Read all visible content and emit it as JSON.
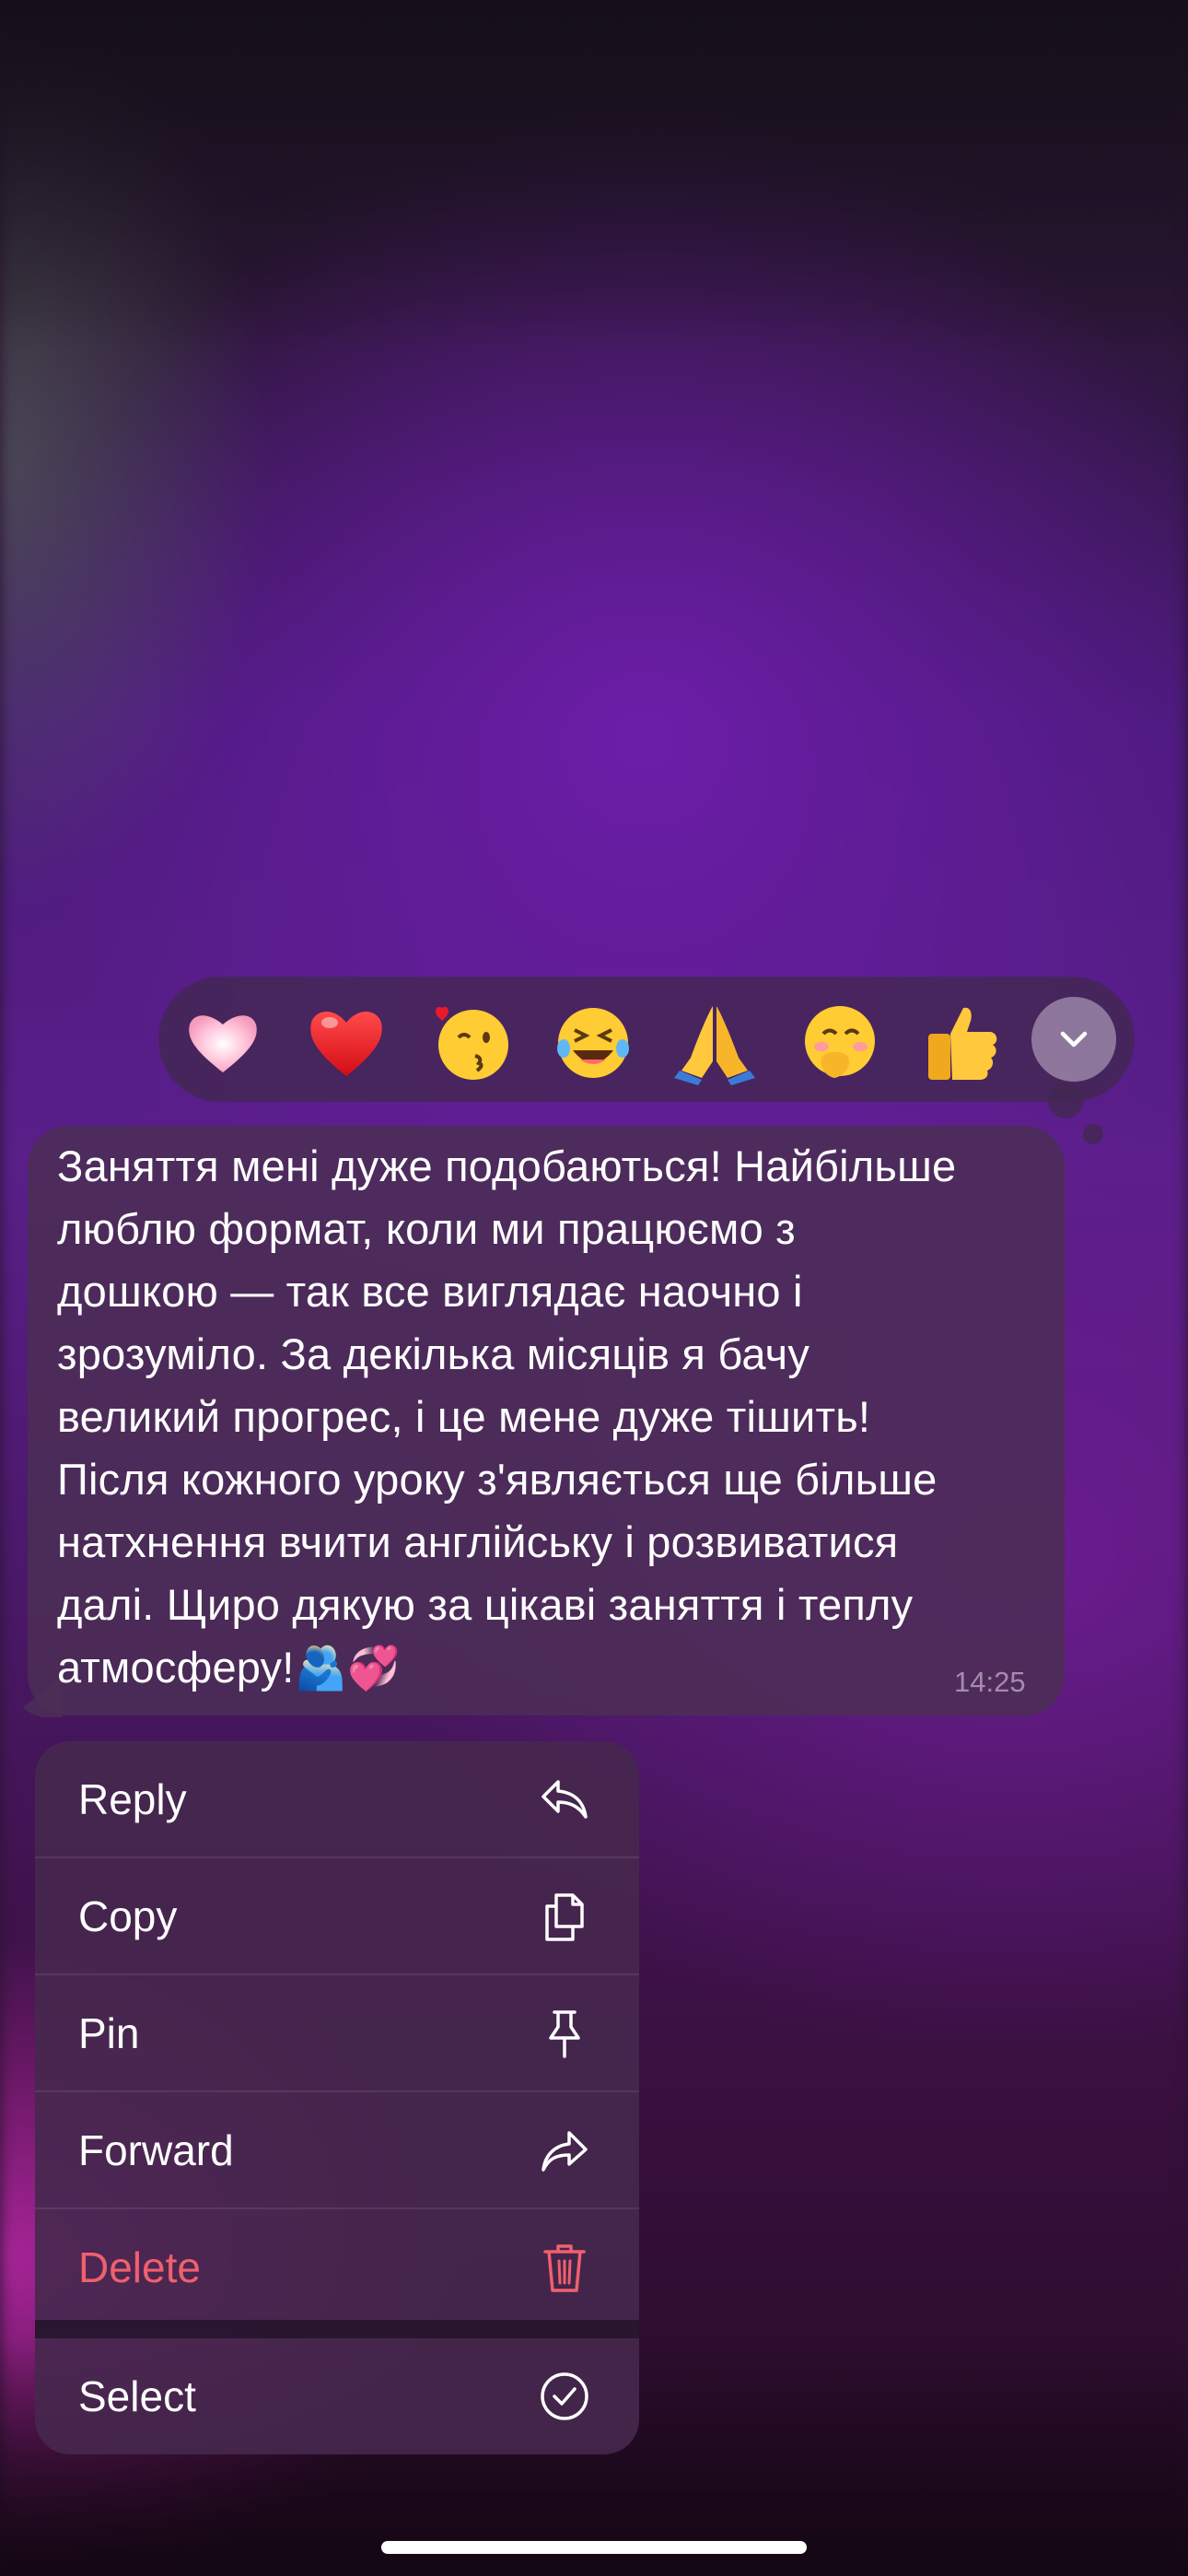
{
  "reactions": [
    {
      "name": "heart-pink",
      "glyph": ""
    },
    {
      "name": "heart-red",
      "glyph": "❤️"
    },
    {
      "name": "face-blowing-kiss",
      "glyph": "😘"
    },
    {
      "name": "face-tears-of-joy",
      "glyph": "😆"
    },
    {
      "name": "folded-hands",
      "glyph": "🙏"
    },
    {
      "name": "face-hand-over-mouth",
      "glyph": "🤭"
    },
    {
      "name": "thumbs-up",
      "glyph": "👍"
    }
  ],
  "message": {
    "lines": [
      "Заняття мені дуже подобаються! Найбільше",
      "люблю формат, коли ми працюємо з",
      "дошкою — так все виглядає наочно і",
      "зрозуміло. За декілька місяців я бачу",
      "великий прогрес, і це мене дуже тішить!",
      "Після кожного уроку з'являється ще більше",
      "натхнення вчити англійську і розвиватися",
      "далі. Щиро дякую за цікаві заняття і теплу",
      "атмосферу!"
    ],
    "trailing_emoji": "🫂💞",
    "time": "14:25"
  },
  "menu": {
    "reply": "Reply",
    "copy": "Copy",
    "pin": "Pin",
    "forward": "Forward",
    "delete": "Delete",
    "select": "Select"
  },
  "colors": {
    "accent_delete": "#f0606e",
    "text": "#ffffff"
  }
}
